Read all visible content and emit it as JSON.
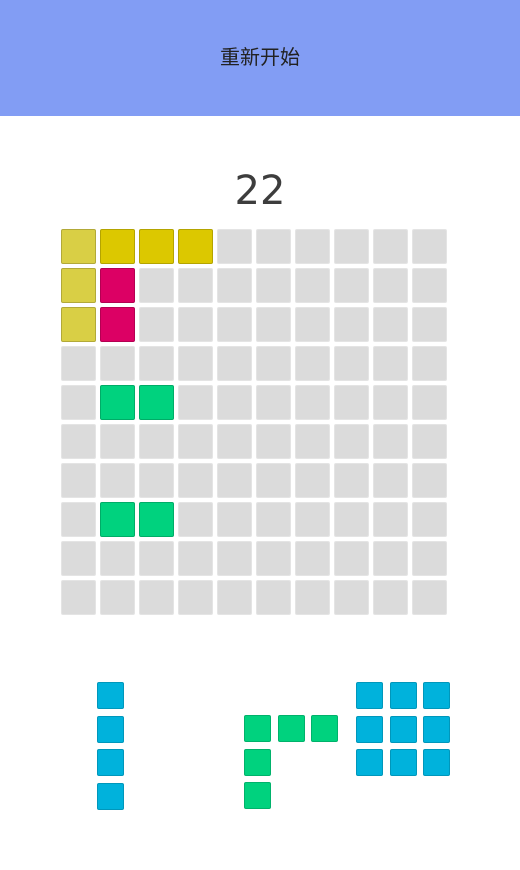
{
  "header": {
    "restart_label": "重新开始",
    "background": "#829df4"
  },
  "score": "22",
  "board": {
    "rows": 10,
    "cols": 10,
    "empty_color": "#dbdbdb",
    "filled": [
      {
        "row": 0,
        "col": 0,
        "color": "#d9cf45"
      },
      {
        "row": 0,
        "col": 1,
        "color": "#dcc800"
      },
      {
        "row": 0,
        "col": 2,
        "color": "#dcc800"
      },
      {
        "row": 0,
        "col": 3,
        "color": "#dcc800"
      },
      {
        "row": 1,
        "col": 0,
        "color": "#d9cf45"
      },
      {
        "row": 1,
        "col": 1,
        "color": "#dc0064"
      },
      {
        "row": 2,
        "col": 0,
        "color": "#d9cf45"
      },
      {
        "row": 2,
        "col": 1,
        "color": "#dc0064"
      },
      {
        "row": 4,
        "col": 1,
        "color": "#00d27e"
      },
      {
        "row": 4,
        "col": 2,
        "color": "#00d27e"
      },
      {
        "row": 7,
        "col": 1,
        "color": "#00d27e"
      },
      {
        "row": 7,
        "col": 2,
        "color": "#00d27e"
      }
    ]
  },
  "pieces": [
    {
      "name": "piece-vertical-i",
      "color": "#00b2dc",
      "cells": [
        [
          0,
          0
        ],
        [
          1,
          0
        ],
        [
          2,
          0
        ],
        [
          3,
          0
        ]
      ]
    },
    {
      "name": "piece-corner-l",
      "color": "#00d27e",
      "cells": [
        [
          0,
          0
        ],
        [
          0,
          1
        ],
        [
          0,
          2
        ],
        [
          1,
          0
        ],
        [
          2,
          0
        ]
      ]
    },
    {
      "name": "piece-square-3x3",
      "color": "#00b2dc",
      "cells": [
        [
          0,
          0
        ],
        [
          0,
          1
        ],
        [
          0,
          2
        ],
        [
          1,
          0
        ],
        [
          1,
          1
        ],
        [
          1,
          2
        ],
        [
          2,
          0
        ],
        [
          2,
          1
        ],
        [
          2,
          2
        ]
      ]
    }
  ]
}
